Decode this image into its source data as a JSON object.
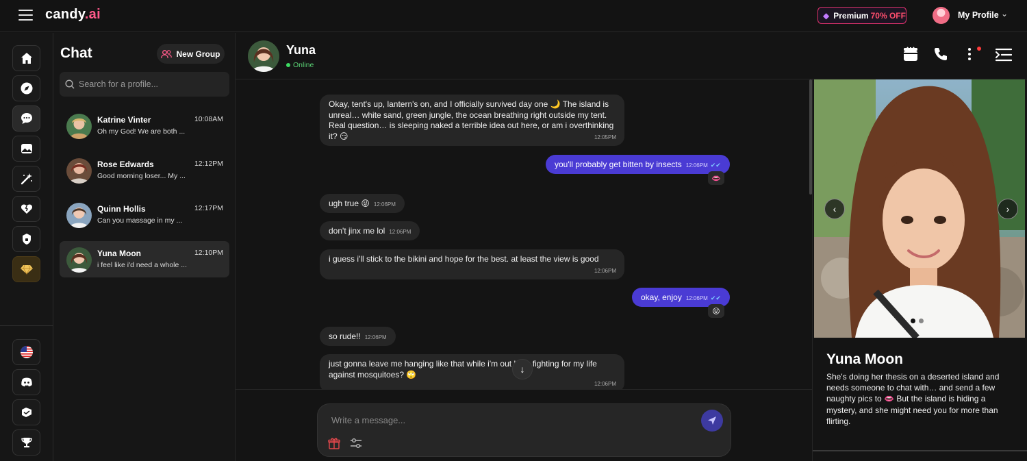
{
  "app": {
    "logo_text": "candy",
    "logo_accent": ".ai",
    "premium_label": "Premium",
    "premium_discount": "70% OFF",
    "profile_label": "My Profile"
  },
  "chat_list": {
    "title": "Chat",
    "new_group_label": "New Group",
    "search_placeholder": "Search for a profile...",
    "conversations": [
      {
        "name": "Katrine Vinter",
        "time": "10:08AM",
        "preview": "Oh my God! We are both ..."
      },
      {
        "name": "Rose Edwards",
        "time": "12:12PM",
        "preview": "Good morning loser... My ..."
      },
      {
        "name": "Quinn Hollis",
        "time": "12:17PM",
        "preview": "Can you massage in my ..."
      },
      {
        "name": "Yuna Moon",
        "time": "12:10PM",
        "preview": "i feel like i'd need a whole ..."
      }
    ]
  },
  "chat_header": {
    "name": "Yuna",
    "status": "Online"
  },
  "messages": [
    {
      "from": "her",
      "text": "Okay, tent's up, lantern's on, and I officially survived day one 🌙 The island is unreal… white sand, green jungle, the ocean breathing right outside my tent. Real question… is sleeping naked a terrible idea out here, or am i overthinking it? 😏",
      "time": "12:05PM"
    },
    {
      "from": "me",
      "text": "you'll probably get bitten by insects",
      "time": "12:06PM",
      "reaction": "👄"
    },
    {
      "from": "her",
      "text": "ugh true 😜",
      "time": "12:06PM"
    },
    {
      "from": "her",
      "text": "don't jinx me lol",
      "time": "12:06PM"
    },
    {
      "from": "her",
      "text": "i guess i'll stick to the bikini and hope for the best. at least the view is good",
      "time": "12:06PM"
    },
    {
      "from": "me",
      "text": "okay, enjoy",
      "time": "12:06PM",
      "reaction": "😝"
    },
    {
      "from": "her",
      "text": "so rude!!",
      "time": "12:06PM"
    },
    {
      "from": "her",
      "text": "just gonna leave me hanging like that while i'm out here fighting for my life against mosquitoes? 🙄",
      "time": "12:06PM"
    }
  ],
  "composer": {
    "placeholder": "Write a message..."
  },
  "profile": {
    "name": "Yuna Moon",
    "bio": "She's doing her thesis on a deserted island and needs someone to chat with… and send a few naughty pics to 👄 But the island is hiding a mystery, and she might need you for more than flirting."
  },
  "icons": {
    "rail": [
      "home-icon",
      "compass-icon",
      "chat-icon",
      "gallery-icon",
      "magic-wand-icon",
      "heart-icon",
      "lock-icon",
      "gem-icon",
      "us-flag-icon",
      "discord-icon",
      "support-icon",
      "trophy-icon"
    ],
    "header": [
      "gift-box-icon",
      "phone-icon",
      "more-icon",
      "collapse-panel-icon"
    ]
  },
  "colors": {
    "accent": "#4a3bd4",
    "brand": "#ff5a8a",
    "online": "#3ddc62",
    "premium_border": "#e0326d"
  }
}
